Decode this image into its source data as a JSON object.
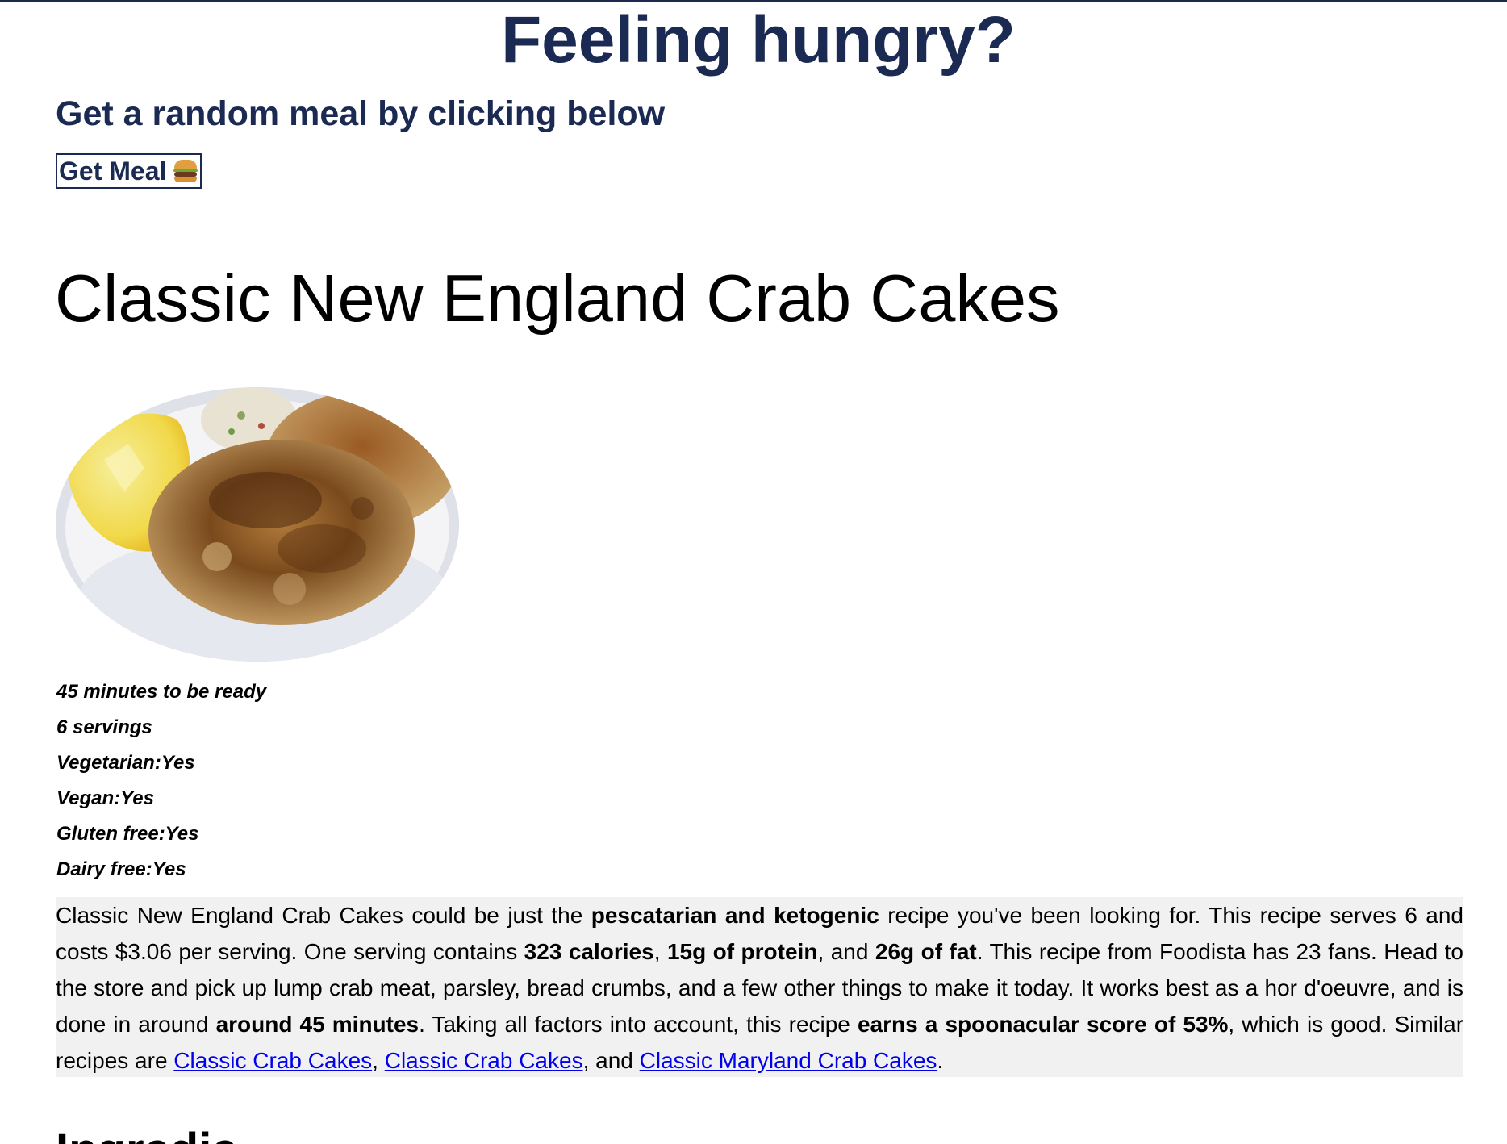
{
  "header": {
    "title": "Feeling hungry?",
    "subtitle": "Get a random meal by clicking below",
    "button_label": "Get Meal",
    "button_icon": "hamburger-icon"
  },
  "recipe": {
    "title": "Classic New England Crab Cakes",
    "image_description": "crab-cake-photo",
    "facts": [
      "45 minutes to be ready",
      "6 servings",
      "Vegetarian:Yes",
      "Vegan:Yes",
      "Gluten free:Yes",
      "Dairy free:Yes"
    ],
    "summary": {
      "p1": "Classic New England Crab Cakes could be just the ",
      "b1": "pescatarian and ketogenic",
      "p2": " recipe you've been looking for. This recipe serves 6 and costs $3.06 per serving. One serving contains ",
      "b2": "323 calories",
      "p3": ", ",
      "b3": "15g of protein",
      "p4": ", and ",
      "b4": "26g of fat",
      "p5": ". This recipe from Foodista has 23 fans. Head to the store and pick up lump crab meat, parsley, bread crumbs, and a few other things to make it today. It works best as a hor d'oeuvre, and is done in around ",
      "b5": "around 45 minutes",
      "p6": ". Taking all factors into account, this recipe ",
      "b6": "earns a spoonacular score of 53%",
      "p7": ", which is good. Similar recipes are ",
      "link1": "Classic Crab Cakes",
      "p8": ", ",
      "link2": "Classic Crab Cakes",
      "p9": ", and ",
      "link3": "Classic Maryland Crab Cakes",
      "p10": "."
    },
    "next_heading": "Ingredients"
  },
  "colors": {
    "heading_navy": "#1b2a52",
    "summary_bg": "#f1f1f1",
    "link": "#0000ee"
  }
}
